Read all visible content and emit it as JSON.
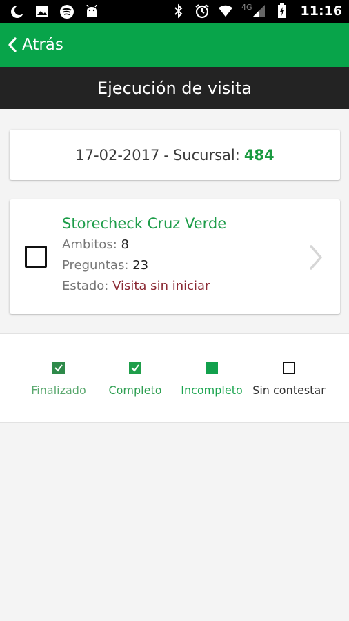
{
  "status_bar": {
    "time": "11:16",
    "network": "4G",
    "left_icons": [
      "moon-icon",
      "image-icon",
      "spotify-icon",
      "android-icon"
    ],
    "right_icons": [
      "bluetooth-icon",
      "alarm-icon",
      "wifi-icon",
      "signal-icon",
      "battery-charging-icon"
    ]
  },
  "app_bar": {
    "back_label": "Atrás",
    "color": "#08a44a"
  },
  "title_bar": {
    "title": "Ejecución de visita"
  },
  "header_card": {
    "date": "17-02-2017",
    "separator": "-",
    "branch_label": "Sucursal:",
    "branch_number": "484"
  },
  "visit": {
    "name": "Storecheck Cruz Verde",
    "ambitos_label": "Ambitos:",
    "ambitos_value": "8",
    "preguntas_label": "Preguntas:",
    "preguntas_value": "23",
    "estado_label": "Estado:",
    "estado_value": "Visita sin iniciar",
    "checked": false
  },
  "legend": {
    "items": [
      {
        "label": "Finalizado",
        "icon": "checked-box-icon",
        "color": "#3e9a5a"
      },
      {
        "label": "Completo",
        "icon": "checked-box-icon",
        "color": "#2f9f52"
      },
      {
        "label": "Incompleto",
        "icon": "filled-box-icon",
        "color": "#1aa44e"
      },
      {
        "label": "Sin contestar",
        "icon": "empty-box-icon",
        "color": "#222222"
      }
    ]
  }
}
